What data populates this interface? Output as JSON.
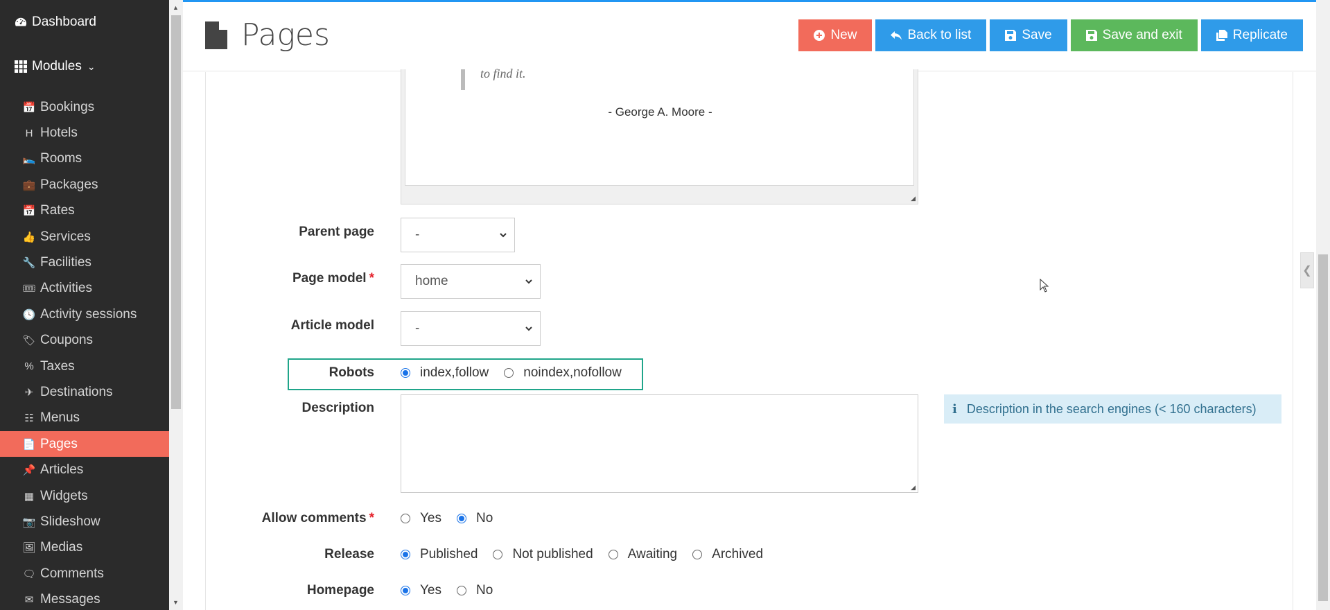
{
  "sidebar": {
    "dashboard": "Dashboard",
    "modules": "Modules",
    "items": [
      {
        "label": "Bookings",
        "icon": "calendar-check-icon"
      },
      {
        "label": "Hotels",
        "icon": "hotel-h-icon"
      },
      {
        "label": "Rooms",
        "icon": "bed-icon"
      },
      {
        "label": "Packages",
        "icon": "suitcase-icon"
      },
      {
        "label": "Rates",
        "icon": "calendar-icon"
      },
      {
        "label": "Services",
        "icon": "thumbs-up-icon"
      },
      {
        "label": "Facilities",
        "icon": "wrench-icon"
      },
      {
        "label": "Activities",
        "icon": "ticket-icon"
      },
      {
        "label": "Activity sessions",
        "icon": "clock-icon"
      },
      {
        "label": "Coupons",
        "icon": "tags-icon"
      },
      {
        "label": "Taxes",
        "icon": "percent-icon"
      },
      {
        "label": "Destinations",
        "icon": "plane-icon"
      },
      {
        "label": "Menus",
        "icon": "sitemap-icon"
      },
      {
        "label": "Pages",
        "icon": "file-icon"
      },
      {
        "label": "Articles",
        "icon": "thumbtack-icon"
      },
      {
        "label": "Widgets",
        "icon": "th-large-icon"
      },
      {
        "label": "Slideshow",
        "icon": "camera-icon"
      },
      {
        "label": "Medias",
        "icon": "images-icon"
      },
      {
        "label": "Comments",
        "icon": "comment-icon"
      },
      {
        "label": "Messages",
        "icon": "envelope-icon"
      }
    ]
  },
  "header": {
    "title": "Pages",
    "buttons": {
      "new": "New",
      "back": "Back to list",
      "save": "Save",
      "save_exit": "Save and exit",
      "replicate": "Replicate"
    }
  },
  "editor": {
    "quote_tail": "to find it.",
    "author": "- George A. Moore -"
  },
  "form": {
    "parent_page": {
      "label": "Parent page",
      "value": "-"
    },
    "page_model": {
      "label": "Page model",
      "required": "*",
      "value": "home"
    },
    "article_model": {
      "label": "Article model",
      "value": "-"
    },
    "robots": {
      "label": "Robots",
      "options": [
        "index,follow",
        "noindex,nofollow"
      ],
      "selected": "index,follow"
    },
    "description": {
      "label": "Description",
      "value": "",
      "help": "Description in the search engines (< 160 characters)"
    },
    "allow_comments": {
      "label": "Allow comments",
      "required": "*",
      "options": [
        "Yes",
        "No"
      ],
      "selected": "No"
    },
    "release": {
      "label": "Release",
      "options": [
        "Published",
        "Not published",
        "Awaiting",
        "Archived"
      ],
      "selected": "Published"
    },
    "homepage": {
      "label": "Homepage",
      "options": [
        "Yes",
        "No"
      ],
      "selected": "Yes"
    }
  },
  "colors": {
    "accent": "#f26b5b",
    "primary": "#2f9be9",
    "success": "#5cb85c",
    "highlight": "#1fa58a"
  }
}
